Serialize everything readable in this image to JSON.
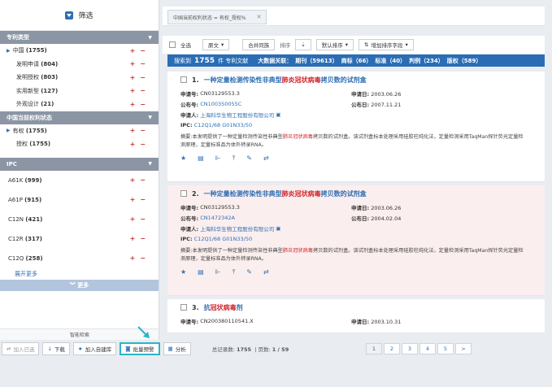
{
  "sidebar": {
    "filter_label": "筛选",
    "sections": [
      {
        "title": "专利类型",
        "items": [
          {
            "label": "中国",
            "count": "(1755)",
            "sub": false
          },
          {
            "label": "发明申请",
            "count": "(804)",
            "sub": true
          },
          {
            "label": "发明授权",
            "count": "(803)",
            "sub": true
          },
          {
            "label": "实用新型",
            "count": "(127)",
            "sub": true
          },
          {
            "label": "外观设计",
            "count": "(21)",
            "sub": true
          }
        ]
      },
      {
        "title": "中国当前权利状态",
        "items": [
          {
            "label": "有权",
            "count": "(1755)",
            "sub": false
          },
          {
            "label": "授权",
            "count": "(1755)",
            "sub": true
          }
        ]
      }
    ],
    "ipc": {
      "title": "IPC",
      "items": [
        {
          "label": "A61K",
          "count": "(999)"
        },
        {
          "label": "A61P",
          "count": "(915)"
        },
        {
          "label": "C12N",
          "count": "(421)"
        },
        {
          "label": "C12R",
          "count": "(317)"
        },
        {
          "label": "C12Q",
          "count": "(258)"
        }
      ]
    },
    "expand_more": "展开更多",
    "more_label": "更多",
    "footer_label": "智能检索"
  },
  "tab": {
    "label": "中国当前权利状态 = 有权_授权%"
  },
  "toolbar": {
    "select_all": "全选",
    "view_mode": "原文",
    "merge_family": "合并同族",
    "sort_label": "排序",
    "sort_value": "默认排序",
    "add_sort_field": "增加排序字段"
  },
  "stats": {
    "search_prefix": "搜索到",
    "count": "1755",
    "type_label": "件 专利文献",
    "related_label": "大数据关联：",
    "aggregates": [
      {
        "label": "期刊",
        "value": "59613"
      },
      {
        "label": "商标",
        "value": "66"
      },
      {
        "label": "标准",
        "value": "40"
      },
      {
        "label": "判例",
        "value": "234"
      },
      {
        "label": "版权",
        "value": "589"
      }
    ]
  },
  "results": [
    {
      "index": "1.",
      "title_pre": "一种定量检测传染性非典型",
      "title_hl": "肺炎冠状病毒",
      "title_post": "拷贝数的试剂盒",
      "app_no_label": "申请号:",
      "app_no": "CN03129553.3",
      "app_date_label": "申请日:",
      "app_date": "2003.06.26",
      "pub_no_label": "公布号:",
      "pub_no": "CN100350055C",
      "pub_date_label": "公布日:",
      "pub_date": "2007.11.21",
      "applicant_label": "申请人:",
      "applicant": "上海科华生物工程股份有限公司",
      "ipc_label": "IPC:",
      "ipc": "C12Q1/68 G01N33/50",
      "abstract_label": "摘要:",
      "abstract_pre": "本发明提供了一种定量检测传染性非典型",
      "abstract_hl": "肺炎冠状病毒",
      "abstract_post": "拷贝数的试剂盒。该试剂盒标本处理采用硅胶柱纯化法，定量检测采用TaqMan探针荧光定量检测原理，定量标准品为体外转录RNA。"
    },
    {
      "index": "2.",
      "title_pre": "一种定量检测传染性非典型",
      "title_hl": "肺炎冠状病毒",
      "title_post": "拷贝数的试剂盒",
      "app_no_label": "申请号:",
      "app_no": "CN03129553.3",
      "app_date_label": "申请日:",
      "app_date": "2003.06.26",
      "pub_no_label": "公布号:",
      "pub_no": "CN1472342A",
      "pub_date_label": "公布日:",
      "pub_date": "2004.02.04",
      "applicant_label": "申请人:",
      "applicant": "上海科华生物工程股份有限公司",
      "ipc_label": "IPC:",
      "ipc": "C12Q1/68 G01N33/50",
      "abstract_label": "摘要:",
      "abstract_pre": "本发明提供了一种定量检测传染性非典型",
      "abstract_hl": "肺炎冠状病毒",
      "abstract_post": "拷贝数的试剂盒。该试剂盒标本处理采用硅胶柱纯化法，定量检测采用TaqMan探针荧光定量检测原理，定量标准品为体外转录RNA。"
    },
    {
      "index": "3.",
      "title_pre": "抗",
      "title_hl": "冠状病毒",
      "title_post": "剂",
      "app_no_label": "申请号:",
      "app_no": "CN200380110541.X",
      "app_date_label": "申请日:",
      "app_date": "2003.10.31"
    }
  ],
  "bottom": {
    "add_selected": "加入已选",
    "download": "下载",
    "add_library": "加入自建库",
    "batch_alert": "批量预警",
    "analysis": "分析",
    "total_label": "总记录数:",
    "total": "1755",
    "pages_label": "页数:",
    "pages_value": "1 / 59",
    "page_buttons": [
      "1",
      "2",
      "3",
      "4",
      "5",
      ">"
    ]
  },
  "colors": {
    "accent": "#2a6db5",
    "highlight": "#d0252c",
    "callout": "#2ab6c8"
  }
}
